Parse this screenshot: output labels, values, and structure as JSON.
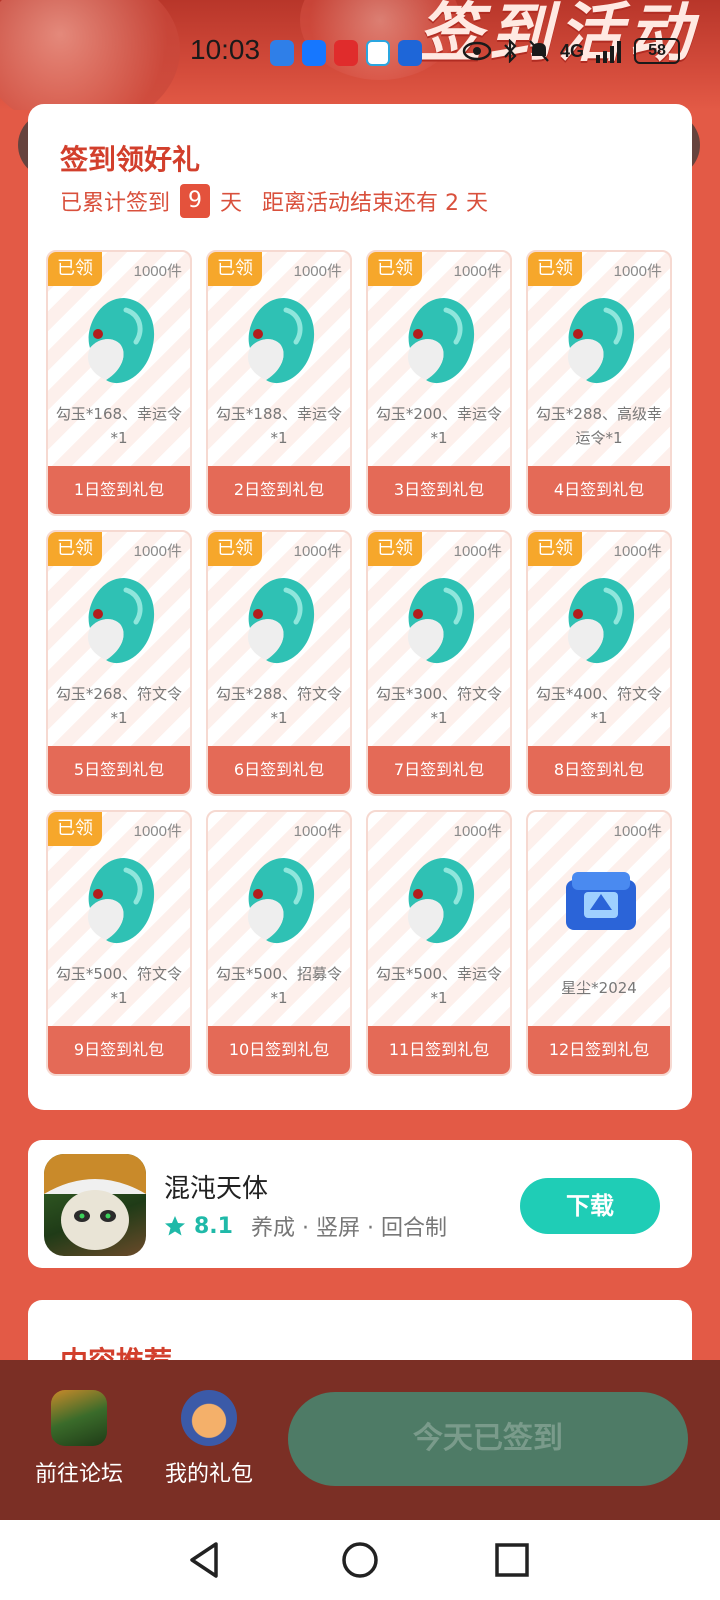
{
  "banner": {
    "title": "签到活动"
  },
  "status_bar": {
    "time": "10:03",
    "network": "4G",
    "battery": "58"
  },
  "sign_card": {
    "title": "签到领好礼",
    "sub_prefix": "已累计签到",
    "days": "9",
    "sub_days_unit": "天",
    "remain_text": "距离活动结束还有 2 天"
  },
  "gifts": [
    {
      "claimed": "已领",
      "qty": "1000件",
      "desc": "勾玉*168、幸运令*1",
      "label": "1日签到礼包",
      "item": "jade"
    },
    {
      "claimed": "已领",
      "qty": "1000件",
      "desc": "勾玉*188、幸运令*1",
      "label": "2日签到礼包",
      "item": "jade"
    },
    {
      "claimed": "已领",
      "qty": "1000件",
      "desc": "勾玉*200、幸运令*1",
      "label": "3日签到礼包",
      "item": "jade"
    },
    {
      "claimed": "已领",
      "qty": "1000件",
      "desc": "勾玉*288、高级幸运令*1",
      "label": "4日签到礼包",
      "item": "jade"
    },
    {
      "claimed": "已领",
      "qty": "1000件",
      "desc": "勾玉*268、符文令*1",
      "label": "5日签到礼包",
      "item": "jade"
    },
    {
      "claimed": "已领",
      "qty": "1000件",
      "desc": "勾玉*288、符文令*1",
      "label": "6日签到礼包",
      "item": "jade"
    },
    {
      "claimed": "已领",
      "qty": "1000件",
      "desc": "勾玉*300、符文令*1",
      "label": "7日签到礼包",
      "item": "jade"
    },
    {
      "claimed": "已领",
      "qty": "1000件",
      "desc": "勾玉*400、符文令*1",
      "label": "8日签到礼包",
      "item": "jade"
    },
    {
      "claimed": "已领",
      "qty": "1000件",
      "desc": "勾玉*500、符文令*1",
      "label": "9日签到礼包",
      "item": "jade"
    },
    {
      "claimed": "",
      "qty": "1000件",
      "desc": "勾玉*500、招募令*1",
      "label": "10日签到礼包",
      "item": "jade"
    },
    {
      "claimed": "",
      "qty": "1000件",
      "desc": "勾玉*500、幸运令*1",
      "label": "11日签到礼包",
      "item": "jade"
    },
    {
      "claimed": "",
      "qty": "1000件",
      "desc": "星尘*2024",
      "label": "12日签到礼包",
      "item": "stardust"
    }
  ],
  "game": {
    "name": "混沌天体",
    "rating": "8.1",
    "tags": "养成 · 竖屏 · 回合制",
    "download_label": "下载"
  },
  "recommend": {
    "title": "内容推荐"
  },
  "bottom_bar": {
    "forum_label": "前往论坛",
    "mygift_label": "我的礼包",
    "signed_label": "今天已签到"
  },
  "colors": {
    "accent": "#e35a46",
    "claimed": "#f6a72b",
    "download": "#1fcdb6",
    "signed_btn": "#4e7b66"
  }
}
